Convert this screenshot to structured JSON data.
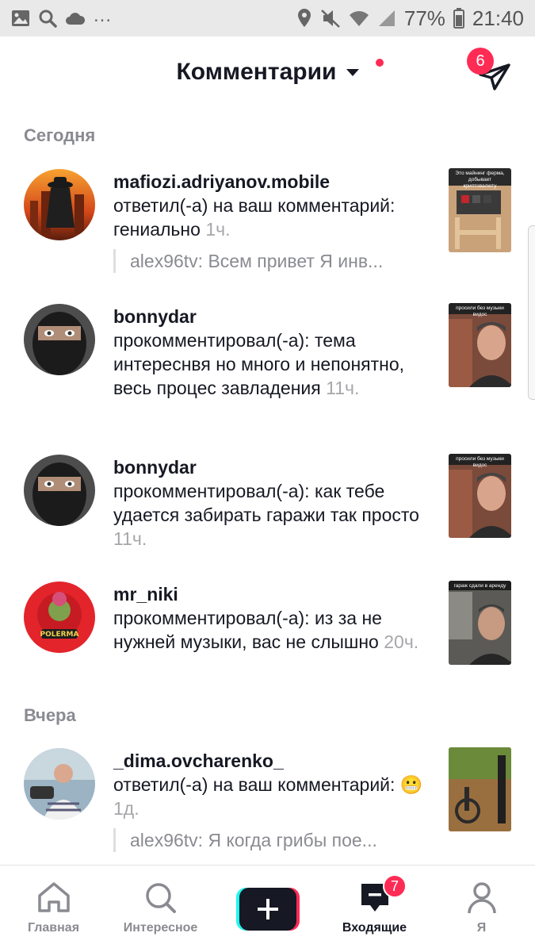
{
  "status_bar": {
    "dots": "...",
    "battery": "77%",
    "time": "21:40"
  },
  "header": {
    "title": "Комментарии",
    "send_badge": "6"
  },
  "sections": {
    "today": "Сегодня",
    "yesterday": "Вчера"
  },
  "items": [
    {
      "username": "mafiozi.adriyanov.mobile",
      "text": "ответил(-а) на ваш комментарий: гениально",
      "time": "1ч.",
      "quote": "alex96tv: Всем привет Я инв...",
      "thumb_caption": "Это майнинг ферма, добывает криптовалюту"
    },
    {
      "username": "bonnydar",
      "text": "прокомментировал(-а): тема интереснвя но много и непонятно, весь процес завладения",
      "time": "11ч.",
      "quote": "",
      "thumb_caption": "просили без музыки видос"
    },
    {
      "username": "bonnydar",
      "text": "прокомментировал(-а): как тебе удается забирать гаражи так просто",
      "time": "11ч.",
      "quote": "",
      "thumb_caption": "просили без музыки видос"
    },
    {
      "username": "mr_niki",
      "text": "прокомментировал(-а): из за не нужней музыки, вас не слышно",
      "time": "20ч.",
      "quote": "",
      "thumb_caption": "гараж сдали в аренду",
      "avatar_text": "POLERMA"
    },
    {
      "username": "_dima.ovcharenko_",
      "text": "ответил(-а) на ваш комментарий: 😬",
      "time": "1д.",
      "quote": "alex96tv: Я когда грибы пое...",
      "thumb_caption": ""
    }
  ],
  "bottom_nav": {
    "home": "Главная",
    "discover": "Интересное",
    "inbox": "Входящие",
    "inbox_badge": "7",
    "me": "Я"
  },
  "colors": {
    "accent": "#fe2c55",
    "text_primary": "#161823",
    "text_secondary": "#8a8b91",
    "tiktok_cyan": "#25f4ee"
  }
}
